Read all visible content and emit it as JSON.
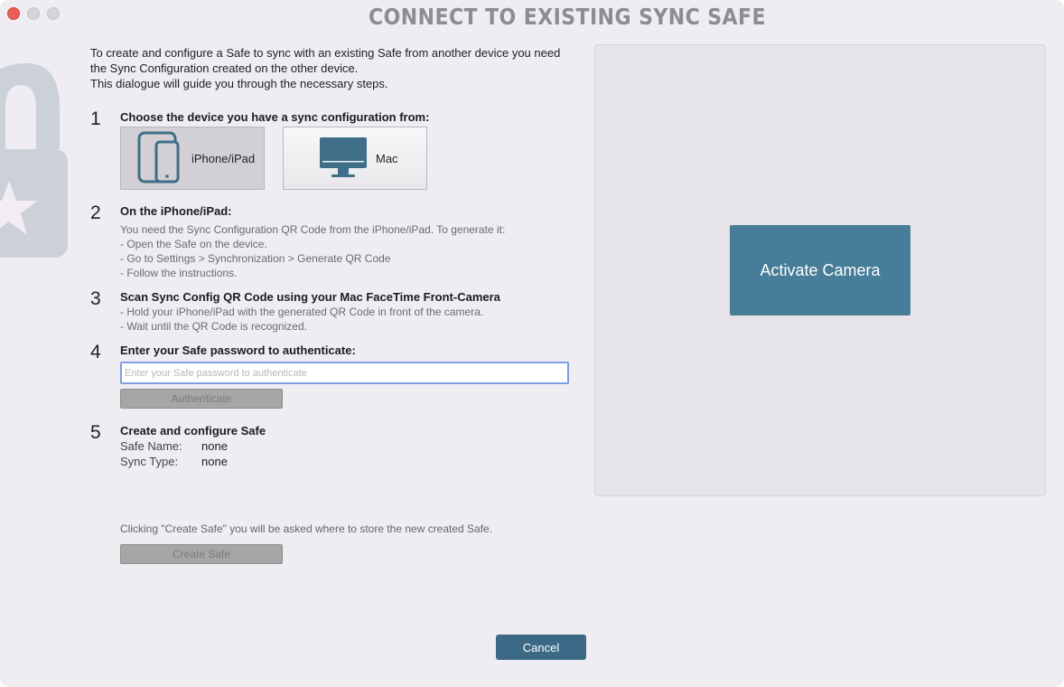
{
  "window": {
    "title": "CONNECT TO EXISTING SYNC SAFE"
  },
  "intro": [
    "To create and configure a Safe to sync with an existing Safe from another device you need",
    "the Sync Configuration created on the other device.",
    "This dialogue will guide you through the necessary steps."
  ],
  "step1": {
    "number": "1",
    "heading": "Choose the device you have a sync configuration from:",
    "devices": [
      {
        "label": "iPhone/iPad",
        "icon": "iphone-ipad-icon",
        "selected": true
      },
      {
        "label": "Mac",
        "icon": "imac-icon",
        "selected": false
      }
    ]
  },
  "step2": {
    "number": "2",
    "heading": "On the iPhone/iPad:",
    "lines": [
      "You need the Sync Configuration QR Code from the iPhone/iPad. To generate it:",
      "- Open the Safe on the device.",
      "- Go to Settings > Synchronization > Generate QR Code",
      "- Follow the instructions."
    ]
  },
  "step3": {
    "number": "3",
    "heading": "Scan Sync Config QR Code using your Mac FaceTime Front-Camera",
    "lines": [
      "- Hold your iPhone/iPad with the generated QR Code in front of the camera.",
      "- Wait until the QR Code is recognized."
    ]
  },
  "step4": {
    "number": "4",
    "heading": "Enter your Safe password to authenticate:",
    "password_placeholder": "Enter your Safe password to authenticate",
    "password_value": "",
    "authenticate_label": "Authenticate"
  },
  "step5": {
    "number": "5",
    "heading": "Create and configure Safe",
    "safe_name_label": "Safe Name:",
    "safe_name_value": "none",
    "sync_type_label": "Sync Type:",
    "sync_type_value": "none"
  },
  "create_note": "Clicking \"Create Safe\" you will be asked where to store the new created Safe.",
  "create_safe_label": "Create Safe",
  "camera": {
    "activate_label": "Activate Camera"
  },
  "cancel_label": "Cancel",
  "colors": {
    "accent": "#477d98",
    "cancel": "#3c6a86",
    "window_bg": "#efecf2",
    "close_dot": "#ec5f57"
  }
}
